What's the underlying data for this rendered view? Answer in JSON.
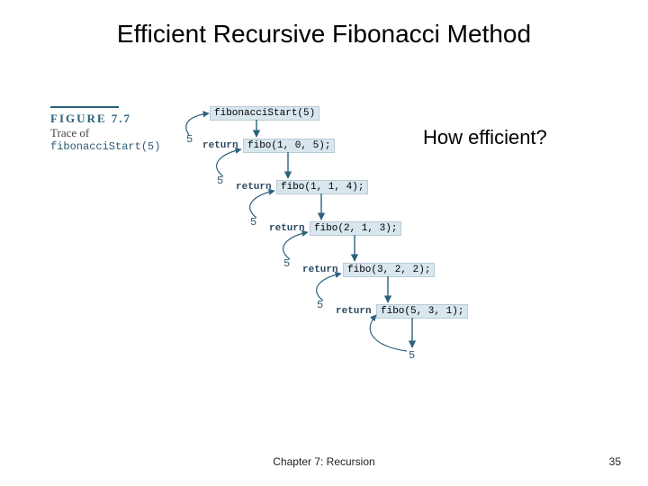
{
  "title": "Efficient Recursive Fibonacci Method",
  "question": "How efficient?",
  "figure": {
    "label": "FIGURE 7.7",
    "caption": "Trace of",
    "code": "fibonacciStart(5)"
  },
  "trace": {
    "start_call": "fibonacciStart(5)",
    "steps": [
      {
        "ret": "return",
        "call": "fibo(1, 0, 5);",
        "result": "5"
      },
      {
        "ret": "return",
        "call": "fibo(1, 1, 4);",
        "result": "5"
      },
      {
        "ret": "return",
        "call": "fibo(2, 1, 3);",
        "result": "5"
      },
      {
        "ret": "return",
        "call": "fibo(3, 2, 2);",
        "result": "5"
      },
      {
        "ret": "return",
        "call": "fibo(5, 3, 1);",
        "result": "5"
      }
    ],
    "final_result": "5"
  },
  "footer": {
    "chapter": "Chapter 7: Recursion",
    "page": "35"
  }
}
